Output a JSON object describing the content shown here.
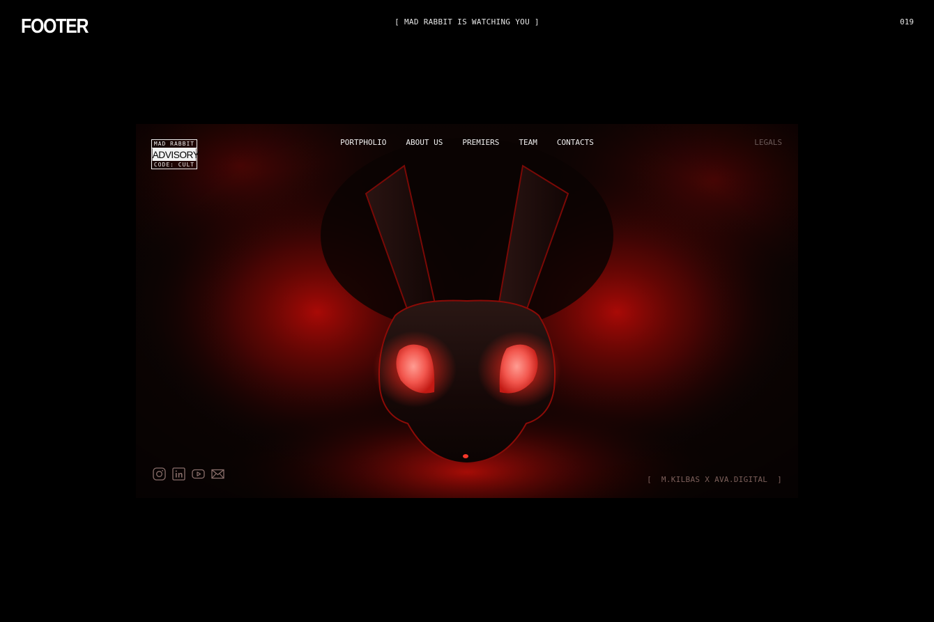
{
  "header": {
    "title": "FOOTER",
    "tagline": "[  MAD RABBIT IS WATCHING YOU  ]",
    "page_number": "019"
  },
  "footer_mockup": {
    "advisory_badge": {
      "top": "MAD RABBIT",
      "middle": "ADVISORY",
      "bottom": "CODE: CULT"
    },
    "nav": [
      {
        "label": "PORTPHOLIO"
      },
      {
        "label": "ABOUT US"
      },
      {
        "label": "PREMIERS"
      },
      {
        "label": "TEAM"
      },
      {
        "label": "CONTACTS"
      }
    ],
    "legals": "LEGALS",
    "socials": [
      "instagram-icon",
      "linkedin-icon",
      "youtube-icon",
      "mail-icon"
    ],
    "credit": "[  M.KILBAS X AVA.DIGITAL  ]",
    "accent_color": "#d0120f",
    "background_color": "#0c0403"
  }
}
